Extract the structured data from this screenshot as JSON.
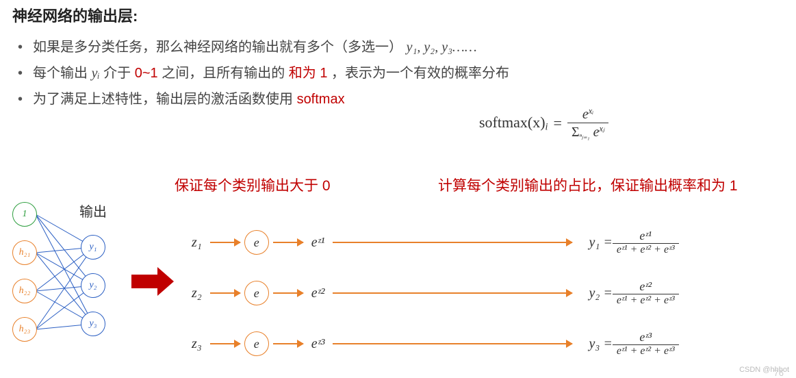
{
  "title": "神经网络的输出层:",
  "bullets": {
    "b1_pre": "如果是多分类任务，那么神经网络的输出就有多个（多选一） ",
    "b1_y": "y₁, y₂, y₃……",
    "b2_a": "每个输出 ",
    "b2_yi": "yᵢ",
    "b2_b": " 介于 ",
    "b2_range": "0~1",
    "b2_c": " 之间，且所有输出的",
    "b2_sum": "和为 1",
    "b2_d": " ，表示为一个有效的概率分布",
    "b3_a": "为了满足上述特性，输出层的激活函数使用 ",
    "b3_sm": "softmax"
  },
  "softmax_formula": {
    "lhs": "softmax(x)",
    "sub": "i",
    "eq": "=",
    "num_base": "e",
    "num_exp": "xᵢ",
    "den_sigma": "Σ",
    "den_limits": "ⁿⱼ₌₁",
    "den_base": "e",
    "den_exp": "xⱼ"
  },
  "anno1": "保证每个类别输出大于 0",
  "anno2": "计算每个类别输出的占比，保证输出概率和为 1",
  "net": {
    "out_label": "输出",
    "bias": "1",
    "h": [
      "h₂₁",
      "h₂₂",
      "h₂₃"
    ],
    "y": [
      "y₁",
      "y₂",
      "y₃"
    ]
  },
  "rows": [
    {
      "z": "z₁",
      "e": "e",
      "ez": "eᶻ¹",
      "y": "y₁",
      "num": "eᶻ¹",
      "den": "eᶻ¹ + eᶻ² + eᶻ³"
    },
    {
      "z": "z₂",
      "e": "e",
      "ez": "eᶻ²",
      "y": "y₂",
      "num": "eᶻ²",
      "den": "eᶻ¹ + eᶻ² + eᶻ³"
    },
    {
      "z": "z₃",
      "e": "e",
      "ez": "eᶻ³",
      "y": "y₃",
      "num": "eᶻ³",
      "den": "eᶻ¹ + eᶻ² + eᶻ³"
    }
  ],
  "watermark": "CSDN @hhbot",
  "pagenum": "76"
}
